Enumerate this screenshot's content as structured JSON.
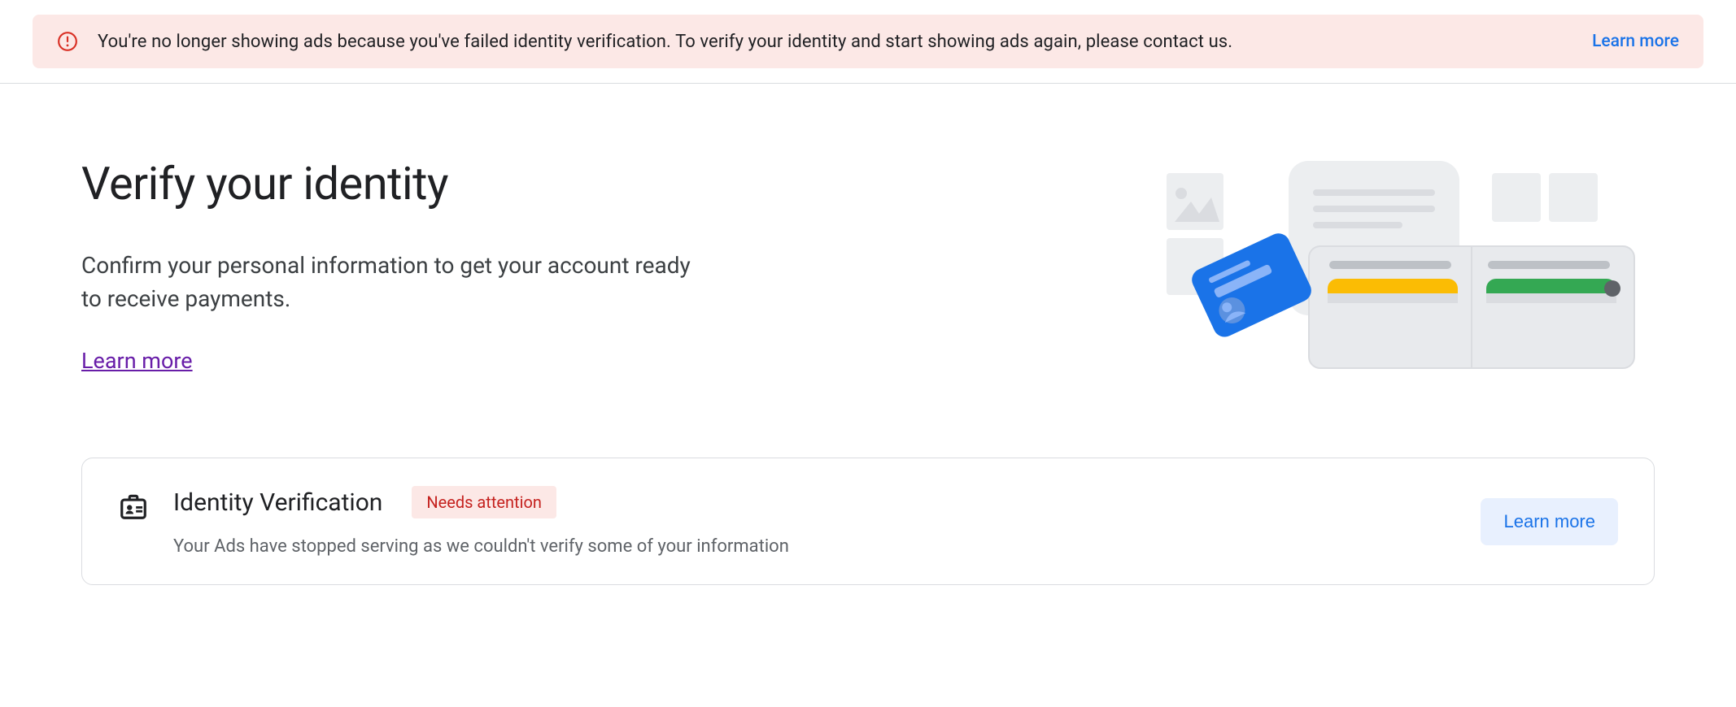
{
  "alert": {
    "message": "You're no longer showing ads because you've failed identity verification. To verify your identity and start showing ads again, please contact us.",
    "learn_more": "Learn more"
  },
  "hero": {
    "title": "Verify your identity",
    "description": "Confirm your personal information to get your account ready to receive payments.",
    "learn_more": "Learn more"
  },
  "card": {
    "title": "Identity Verification",
    "badge": "Needs attention",
    "description": "Your Ads have stopped serving as we couldn't verify some of your information",
    "action": "Learn more"
  }
}
